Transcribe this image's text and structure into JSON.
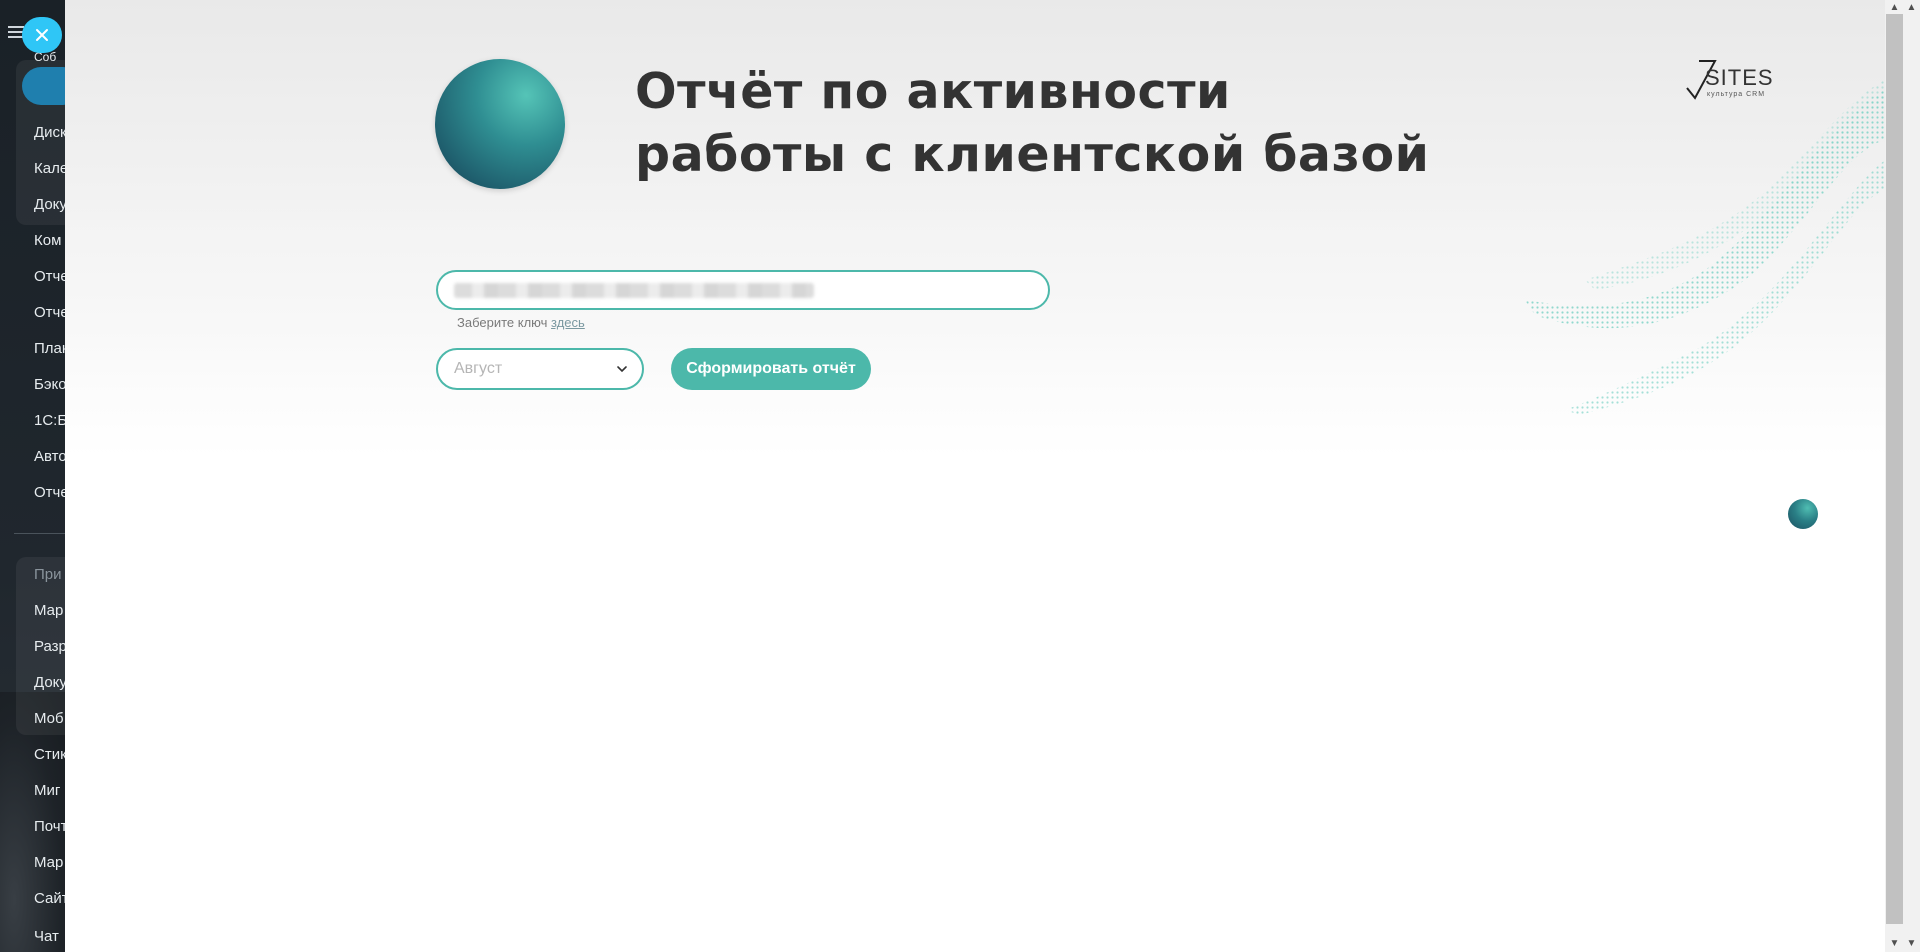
{
  "background_sidebar": {
    "items": [
      {
        "label": "Соб"
      },
      {
        "label": "Диск"
      },
      {
        "label": "Кале"
      },
      {
        "label": "Доку"
      },
      {
        "label": "Ком"
      },
      {
        "label": "Отче"
      },
      {
        "label": "Отче"
      },
      {
        "label": "План"
      },
      {
        "label": "Бэко"
      },
      {
        "label": "1С:Б"
      },
      {
        "label": "Авто"
      },
      {
        "label": "Отче"
      },
      {
        "label": "При"
      },
      {
        "label": "Мар"
      },
      {
        "label": "Разр"
      },
      {
        "label": "Доку"
      },
      {
        "label": "Моб"
      },
      {
        "label": "Стик"
      },
      {
        "label": "Миг"
      },
      {
        "label": "Почт"
      },
      {
        "label": "Мар"
      },
      {
        "label": "Сайт"
      },
      {
        "label": "Чат"
      }
    ]
  },
  "panel": {
    "title_line1": "Отчёт по активности",
    "title_line2": "работы с клиентской базой",
    "logo": {
      "word": "SITES",
      "sub": "культура CRM"
    },
    "key_input": {
      "value": ""
    },
    "hint": {
      "text": "Заберите ключ ",
      "link": "здесь"
    },
    "period_select": {
      "value": "Август"
    },
    "submit_label": "Сформировать отчёт"
  },
  "colors": {
    "accent": "#4cb8aa",
    "close_button": "#2fc6f6",
    "title": "#333333"
  },
  "icons": {
    "close": "close-icon",
    "menu": "hamburger-icon",
    "select": "chevron-down-icon"
  }
}
